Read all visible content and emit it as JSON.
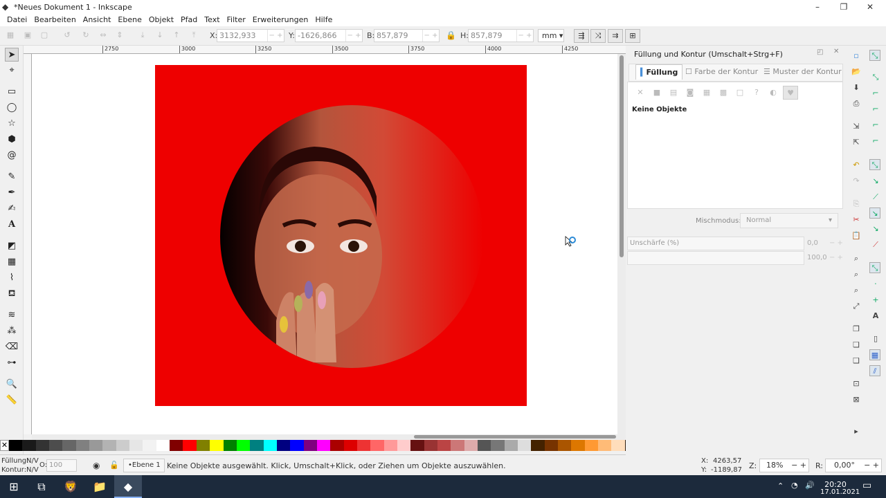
{
  "window": {
    "title": "*Neues Dokument 1 - Inkscape"
  },
  "menu": [
    "Datei",
    "Bearbeiten",
    "Ansicht",
    "Ebene",
    "Objekt",
    "Pfad",
    "Text",
    "Filter",
    "Erweiterungen",
    "Hilfe"
  ],
  "toolbar": {
    "x_label": "X:",
    "x_value": "3132,933",
    "y_label": "Y:",
    "y_value": "-1626,866",
    "w_label": "B:",
    "w_value": "857,879",
    "h_label": "H:",
    "h_value": "857,879",
    "unit": "mm"
  },
  "ruler": {
    "ticks": [
      "2750",
      "3000",
      "3250",
      "3500",
      "3750",
      "4000",
      "4250"
    ]
  },
  "dock": {
    "title": "Füllung und Kontur (Umschalt+Strg+F)",
    "tabs": [
      "Füllung",
      "Farbe der Kontur",
      "Muster der Kontur"
    ],
    "no_objects": "Keine Objekte",
    "blend_label": "Mischmodus:",
    "blend_value": "Normal",
    "blur_label": "Unschärfe (%)",
    "blur_value": "0,0",
    "opacity_value": "100,0"
  },
  "status": {
    "fill_label": "Füllung:",
    "fill_value": "N/V",
    "stroke_label": "Kontur:",
    "stroke_value": "N/V",
    "opacity_label": "O:",
    "opacity_value": "100",
    "layer": "•Ebene 1",
    "message": "Keine Objekte ausgewählt. Klick, Umschalt+Klick, oder Ziehen um Objekte auszuwählen.",
    "cursor_x_label": "X:",
    "cursor_x": "4263,57",
    "cursor_y_label": "Y:",
    "cursor_y": "-1189,87",
    "zoom_label": "Z:",
    "zoom": "18%",
    "rotation_label": "R:",
    "rotation": "0,00°"
  },
  "taskbar": {
    "time": "20:20",
    "date": "17.01.2021"
  },
  "colors": {
    "accent_red": "#ee0000"
  }
}
